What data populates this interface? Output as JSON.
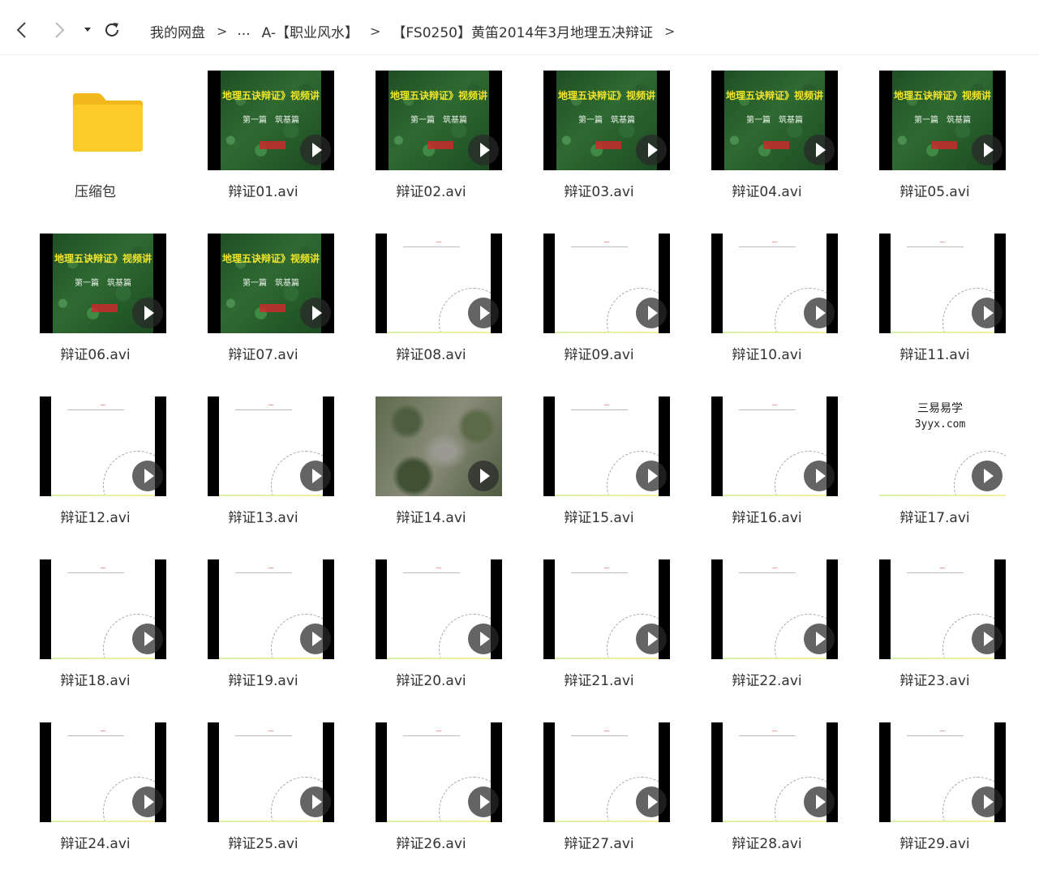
{
  "toolbar": {
    "back_icon": "chevron-left-icon",
    "forward_icon": "chevron-right-icon",
    "history_icon": "caret-down-icon",
    "refresh_icon": "refresh-icon"
  },
  "breadcrumb": {
    "root": "我的网盘",
    "ellipsis": "...",
    "level1": "A-【职业风水】",
    "level2": "【FS0250】黄笛2014年3月地理五决辩证",
    "separator": ">"
  },
  "thumbnail_text": {
    "green_title": "地理五诀辩证》视频讲",
    "green_sub": "第一篇　筑基篇",
    "watermark_line1": "三易易学",
    "watermark_line2": "3yyx.com"
  },
  "colors": {
    "folder": "#fbcb2a",
    "play_overlay": "#2a2a2a"
  },
  "items": [
    {
      "name": "压缩包",
      "type": "folder"
    },
    {
      "name": "辩证01.avi",
      "type": "video",
      "thumb": "green"
    },
    {
      "name": "辩证02.avi",
      "type": "video",
      "thumb": "green"
    },
    {
      "name": "辩证03.avi",
      "type": "video",
      "thumb": "green"
    },
    {
      "name": "辩证04.avi",
      "type": "video",
      "thumb": "green"
    },
    {
      "name": "辩证05.avi",
      "type": "video",
      "thumb": "green"
    },
    {
      "name": "辩证06.avi",
      "type": "video",
      "thumb": "green"
    },
    {
      "name": "辩证07.avi",
      "type": "video",
      "thumb": "green"
    },
    {
      "name": "辩证08.avi",
      "type": "video",
      "thumb": "white"
    },
    {
      "name": "辩证09.avi",
      "type": "video",
      "thumb": "white"
    },
    {
      "name": "辩证10.avi",
      "type": "video",
      "thumb": "white"
    },
    {
      "name": "辩证11.avi",
      "type": "video",
      "thumb": "white"
    },
    {
      "name": "辩证12.avi",
      "type": "video",
      "thumb": "white"
    },
    {
      "name": "辩证13.avi",
      "type": "video",
      "thumb": "white"
    },
    {
      "name": "辩证14.avi",
      "type": "video",
      "thumb": "aerial"
    },
    {
      "name": "辩证15.avi",
      "type": "video",
      "thumb": "white"
    },
    {
      "name": "辩证16.avi",
      "type": "video",
      "thumb": "white"
    },
    {
      "name": "辩证17.avi",
      "type": "video",
      "thumb": "watermark"
    },
    {
      "name": "辩证18.avi",
      "type": "video",
      "thumb": "white"
    },
    {
      "name": "辩证19.avi",
      "type": "video",
      "thumb": "white"
    },
    {
      "name": "辩证20.avi",
      "type": "video",
      "thumb": "white"
    },
    {
      "name": "辩证21.avi",
      "type": "video",
      "thumb": "white"
    },
    {
      "name": "辩证22.avi",
      "type": "video",
      "thumb": "white"
    },
    {
      "name": "辩证23.avi",
      "type": "video",
      "thumb": "white"
    },
    {
      "name": "辩证24.avi",
      "type": "video",
      "thumb": "white"
    },
    {
      "name": "辩证25.avi",
      "type": "video",
      "thumb": "white"
    },
    {
      "name": "辩证26.avi",
      "type": "video",
      "thumb": "white"
    },
    {
      "name": "辩证27.avi",
      "type": "video",
      "thumb": "white"
    },
    {
      "name": "辩证28.avi",
      "type": "video",
      "thumb": "white"
    },
    {
      "name": "辩证29.avi",
      "type": "video",
      "thumb": "white"
    }
  ]
}
